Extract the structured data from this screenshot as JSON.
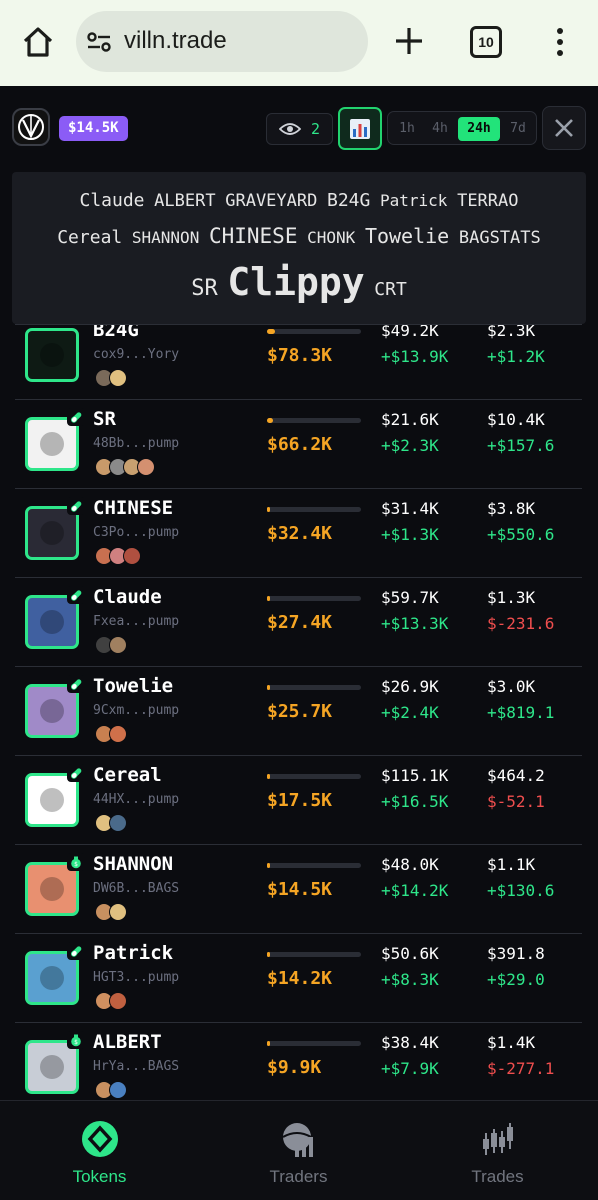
{
  "browser": {
    "url": "villn.trade",
    "tab_count": "10"
  },
  "header": {
    "balance": "$14.5K",
    "watchers": "2",
    "timeframes": [
      "1h",
      "4h",
      "24h",
      "7d"
    ],
    "active_timeframe": "24h"
  },
  "cloud": {
    "line1": [
      "Claude",
      "ALBERT",
      "GRAVEYARD",
      "B24G",
      "Patrick",
      "TERRAO"
    ],
    "line2": [
      "Cereal",
      "SHANNON",
      "CHINESE",
      "CHONK",
      "Towelie",
      "BAGSTATS"
    ],
    "line3": [
      "SR",
      "Clippy",
      "CRT"
    ]
  },
  "tokens": [
    {
      "name": "B24G",
      "addr": "cox9...Yory",
      "progress": 0.08,
      "mcap": "$78.3K",
      "vol": "$49.2K",
      "vol_change": "+$13.9K",
      "liq": "$2.3K",
      "liq_change": "+$1.2K",
      "liq_negative": false,
      "badge": "none",
      "holders": [
        "#7a6a5a",
        "#e0c080"
      ],
      "avatar_color": "#0e1a14"
    },
    {
      "name": "SR",
      "addr": "48Bb...pump",
      "progress": 0.06,
      "mcap": "$66.2K",
      "vol": "$21.6K",
      "vol_change": "+$2.3K",
      "liq": "$10.4K",
      "liq_change": "+$157.6",
      "liq_negative": false,
      "badge": "pill",
      "holders": [
        "#c89a6a",
        "#8a8a8a",
        "#c8a070",
        "#d49070"
      ],
      "avatar_color": "#f2f2f2"
    },
    {
      "name": "CHINESE",
      "addr": "C3Po...pump",
      "progress": 0.03,
      "mcap": "$32.4K",
      "vol": "$31.4K",
      "vol_change": "+$1.3K",
      "liq": "$3.8K",
      "liq_change": "+$550.6",
      "liq_negative": false,
      "badge": "pill",
      "holders": [
        "#c87050",
        "#d08080",
        "#b05040"
      ],
      "avatar_color": "#2a2a35"
    },
    {
      "name": "Claude",
      "addr": "Fxea...pump",
      "progress": 0.03,
      "mcap": "$27.4K",
      "vol": "$59.7K",
      "vol_change": "+$13.3K",
      "liq": "$1.3K",
      "liq_change": "$-231.6",
      "liq_negative": true,
      "badge": "pill",
      "holders": [
        "#404040",
        "#a08060"
      ],
      "avatar_color": "#4060a0"
    },
    {
      "name": "Towelie",
      "addr": "9Cxm...pump",
      "progress": 0.02,
      "mcap": "$25.7K",
      "vol": "$26.9K",
      "vol_change": "+$2.4K",
      "liq": "$3.0K",
      "liq_change": "+$819.1",
      "liq_negative": false,
      "badge": "pill",
      "holders": [
        "#c88050",
        "#d0704a"
      ],
      "avatar_color": "#a08ac8"
    },
    {
      "name": "Cereal",
      "addr": "44HX...pump",
      "progress": 0.02,
      "mcap": "$17.5K",
      "vol": "$115.1K",
      "vol_change": "+$16.5K",
      "liq": "$464.2",
      "liq_change": "$-52.1",
      "liq_negative": true,
      "badge": "pill",
      "holders": [
        "#e0c080",
        "#4a6a8a"
      ],
      "avatar_color": "#ffffff"
    },
    {
      "name": "SHANNON",
      "addr": "DW6B...BAGS",
      "progress": 0.02,
      "mcap": "$14.5K",
      "vol": "$48.0K",
      "vol_change": "+$14.2K",
      "liq": "$1.1K",
      "liq_change": "+$130.6",
      "liq_negative": false,
      "badge": "bag",
      "holders": [
        "#c89060",
        "#e0c080"
      ],
      "avatar_color": "#e89070"
    },
    {
      "name": "Patrick",
      "addr": "HGT3...pump",
      "progress": 0.02,
      "mcap": "$14.2K",
      "vol": "$50.6K",
      "vol_change": "+$8.3K",
      "liq": "$391.8",
      "liq_change": "+$29.0",
      "liq_negative": false,
      "badge": "pill",
      "holders": [
        "#d09060",
        "#c06040"
      ],
      "avatar_color": "#5aa0d0"
    },
    {
      "name": "ALBERT",
      "addr": "HrYa...BAGS",
      "progress": 0.01,
      "mcap": "$9.9K",
      "vol": "$38.4K",
      "vol_change": "+$7.9K",
      "liq": "$1.4K",
      "liq_change": "$-277.1",
      "liq_negative": true,
      "badge": "bag",
      "holders": [
        "#c89060",
        "#4a80c0"
      ],
      "avatar_color": "#c8cdd6"
    }
  ],
  "nav": {
    "tokens": "Tokens",
    "traders": "Traders",
    "trades": "Trades"
  }
}
